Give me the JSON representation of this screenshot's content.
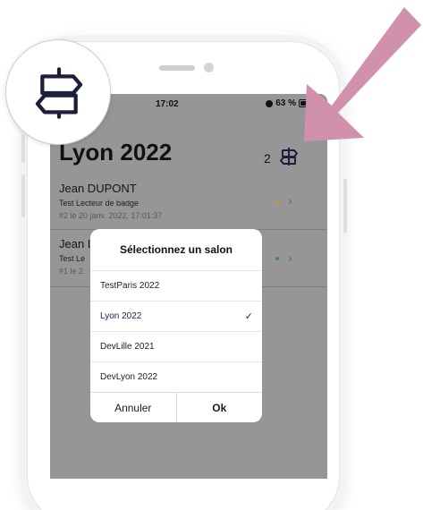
{
  "status_bar": {
    "time": "17:02",
    "battery": "63 %"
  },
  "header": {
    "title": "Lyon 2022",
    "count": "2",
    "salon_icon": "signpost-icon"
  },
  "visits": [
    {
      "name": "Jean DUPONT",
      "subtitle": "Test Lecteur de badge",
      "meta": "#2 le 20 janv. 2022, 17:01:37",
      "status_color": "#c79a2d"
    },
    {
      "name": "Jean DUPONT",
      "name_visible": "Jean I",
      "subtitle_visible": "Test Le",
      "meta_visible": "#1 le 2",
      "status_color": "#3f8f52"
    }
  ],
  "modal": {
    "title": "Sélectionnez un salon",
    "options": [
      {
        "label": "TestParis 2022",
        "selected": false
      },
      {
        "label": "Lyon 2022",
        "selected": true
      },
      {
        "label": "DevLille 2021",
        "selected": false
      },
      {
        "label": "DevLyon 2022",
        "selected": false
      }
    ],
    "check_mark": "✓",
    "cancel_label": "Annuler",
    "ok_label": "Ok"
  },
  "overlay": {
    "zoom_icon": "signpost-icon",
    "arrow_color": "#d191ad"
  },
  "chevron": "›"
}
